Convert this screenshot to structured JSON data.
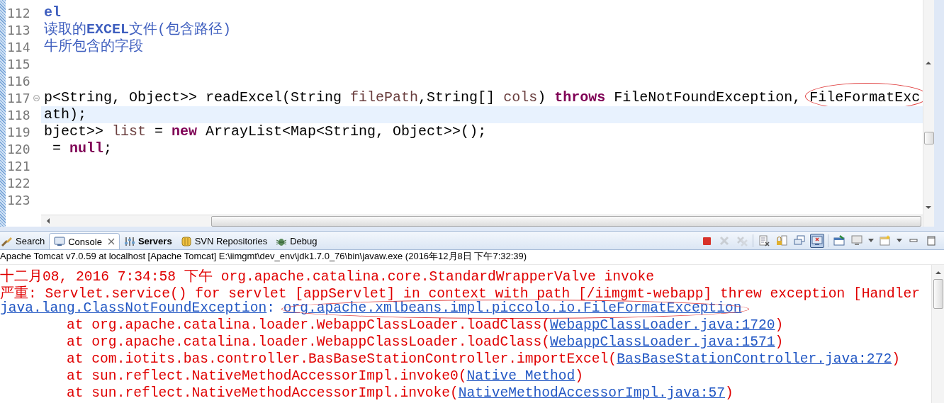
{
  "editor": {
    "lines": [
      {
        "number": "112",
        "current": false,
        "collapsible": false,
        "segments": [
          {
            "text": "el",
            "kind": "comment-bold"
          }
        ]
      },
      {
        "number": "113",
        "current": false,
        "collapsible": false,
        "segments": [
          {
            "text": "读取的",
            "kind": "comment"
          },
          {
            "text": "EXCEL",
            "kind": "comment-bold"
          },
          {
            "text": "文件(包含路径)",
            "kind": "comment"
          }
        ]
      },
      {
        "number": "114",
        "current": false,
        "collapsible": false,
        "segments": [
          {
            "text": "牛所包含的字段",
            "kind": "comment"
          }
        ]
      },
      {
        "number": "115",
        "current": false,
        "collapsible": false
      },
      {
        "number": "116",
        "current": false,
        "collapsible": false
      },
      {
        "number": "117",
        "current": false,
        "collapsible": true,
        "segments": [
          {
            "text": "p<String, Object>> readExcel(String ",
            "kind": "plain"
          },
          {
            "text": "filePath",
            "kind": "variable"
          },
          {
            "text": ",String[] ",
            "kind": "plain"
          },
          {
            "text": "cols",
            "kind": "variable"
          },
          {
            "text": ") ",
            "kind": "plain"
          },
          {
            "text": "throws",
            "kind": "keyword"
          },
          {
            "text": " FileNotFoundException, ",
            "kind": "plain"
          },
          {
            "text": "FileFormatExc",
            "kind": "plain",
            "circled": true
          }
        ]
      },
      {
        "number": "118",
        "current": true,
        "collapsible": false,
        "segments": [
          {
            "text": "ath);",
            "kind": "plain"
          }
        ]
      },
      {
        "number": "119",
        "current": false,
        "collapsible": false,
        "segments": [
          {
            "text": "bject>> ",
            "kind": "plain"
          },
          {
            "text": "list",
            "kind": "variable"
          },
          {
            "text": " = ",
            "kind": "plain"
          },
          {
            "text": "new",
            "kind": "keyword"
          },
          {
            "text": " ArrayList<Map<String, Object>>();",
            "kind": "plain"
          }
        ]
      },
      {
        "number": "120",
        "current": false,
        "collapsible": false,
        "segments": [
          {
            "text": " = ",
            "kind": "plain"
          },
          {
            "text": "null",
            "kind": "keyword"
          },
          {
            "text": ";",
            "kind": "plain"
          }
        ]
      },
      {
        "number": "121",
        "current": false,
        "collapsible": false
      },
      {
        "number": "122",
        "current": false,
        "collapsible": false
      },
      {
        "number": "123",
        "current": false,
        "collapsible": false
      }
    ]
  },
  "console": {
    "tabs": [
      {
        "label": "Search",
        "kind": "search",
        "selected": false,
        "closable": false
      },
      {
        "label": "Console",
        "kind": "console",
        "selected": true,
        "closable": true
      },
      {
        "label": "Servers",
        "kind": "servers",
        "selected": false,
        "closable": false
      },
      {
        "label": "SVN Repositories",
        "kind": "svn",
        "selected": false,
        "closable": false
      },
      {
        "label": "Debug",
        "kind": "debug",
        "selected": false,
        "closable": false
      }
    ],
    "toolbar": [
      {
        "kind": "stop",
        "disabled": false,
        "pressed": false
      },
      {
        "kind": "remove",
        "disabled": true,
        "pressed": false
      },
      {
        "kind": "remove-all",
        "disabled": true,
        "pressed": false
      },
      {
        "kind": "separator"
      },
      {
        "kind": "clear",
        "disabled": false,
        "pressed": false
      },
      {
        "kind": "scroll-lock",
        "disabled": false,
        "pressed": false
      },
      {
        "kind": "show-out",
        "disabled": false,
        "pressed": false
      },
      {
        "kind": "show-err",
        "disabled": false,
        "pressed": true
      },
      {
        "kind": "separator"
      },
      {
        "kind": "pin",
        "disabled": false,
        "pressed": false
      },
      {
        "kind": "display",
        "disabled": false,
        "pressed": false
      },
      {
        "kind": "dropdown",
        "disabled": false,
        "pressed": false
      },
      {
        "kind": "new",
        "disabled": false,
        "pressed": false
      },
      {
        "kind": "dropdown",
        "disabled": false,
        "pressed": false
      },
      {
        "kind": "minimize",
        "disabled": false,
        "pressed": false
      },
      {
        "kind": "maximize",
        "disabled": false,
        "pressed": false
      }
    ],
    "process": "Apache Tomcat v7.0.59 at localhost [Apache Tomcat] E:\\iimgmt\\dev_env\\jdk1.7.0_76\\bin\\javaw.exe (2016年12月8日 下午7:32:39)",
    "lines": [
      {
        "segments": [
          {
            "text": "十二月08, 2016 7:34:58 下午 org.apache.catalina.core.StandardWrapperValve invoke",
            "kind": "error"
          }
        ]
      },
      {
        "segments": [
          {
            "text": "严重: Servlet.service() for servlet [appServlet] in context with path [/iimgmt-webapp] threw exception [Handler",
            "kind": "error"
          }
        ]
      },
      {
        "segments": [
          {
            "text": "java.lang.ClassNotFoundException",
            "kind": "link"
          },
          {
            "text": ": ",
            "kind": "link-plain"
          },
          {
            "text": "org.apache.xmlbeans.impl.piccolo.io.FileFormatException",
            "kind": "link",
            "circled": true
          }
        ]
      },
      {
        "segments": [
          {
            "text": "\tat org.apache.catalina.loader.WebappClassLoader.loadClass(",
            "kind": "error"
          },
          {
            "text": "WebappClassLoader.java:1720",
            "kind": "link"
          },
          {
            "text": ")",
            "kind": "error"
          }
        ]
      },
      {
        "segments": [
          {
            "text": "\tat org.apache.catalina.loader.WebappClassLoader.loadClass(",
            "kind": "error"
          },
          {
            "text": "WebappClassLoader.java:1571",
            "kind": "link"
          },
          {
            "text": ")",
            "kind": "error"
          }
        ]
      },
      {
        "segments": [
          {
            "text": "\tat com.iotits.bas.controller.BasBaseStationController.importExcel(",
            "kind": "error"
          },
          {
            "text": "BasBaseStationController.java:272",
            "kind": "link"
          },
          {
            "text": ")",
            "kind": "error"
          }
        ]
      },
      {
        "segments": [
          {
            "text": "\tat sun.reflect.NativeMethodAccessorImpl.invoke0(",
            "kind": "error"
          },
          {
            "text": "Native Method",
            "kind": "link"
          },
          {
            "text": ")",
            "kind": "error"
          }
        ]
      },
      {
        "segments": [
          {
            "text": "\tat sun.reflect.NativeMethodAccessorImpl.invoke(",
            "kind": "error"
          },
          {
            "text": "NativeMethodAccessorImpl.java:57",
            "kind": "link"
          },
          {
            "text": ")",
            "kind": "error"
          }
        ]
      }
    ]
  }
}
